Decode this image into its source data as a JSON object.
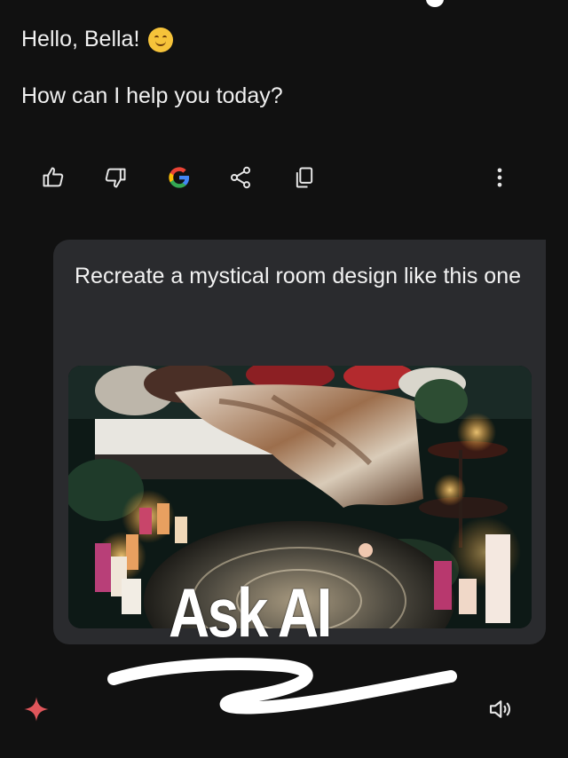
{
  "greeting": {
    "text": "Hello, Bella!",
    "emoji": "smiling-face"
  },
  "prompt": {
    "text": "How can I help you today?"
  },
  "actions": [
    {
      "name": "thumbs-up",
      "label": "Good response"
    },
    {
      "name": "thumbs-down",
      "label": "Bad response"
    },
    {
      "name": "google",
      "label": "G"
    },
    {
      "name": "share",
      "label": "Share"
    },
    {
      "name": "copy",
      "label": "Copy"
    },
    {
      "name": "more",
      "label": "More"
    }
  ],
  "user_message": {
    "text": "Recreate a mystical room design like this one",
    "image_alt": "mystical room with fur throw, pillows, candles and plants"
  },
  "overlay": {
    "title": "Ask AI"
  },
  "bottom": {
    "sparkle_icon": "sparkle-icon",
    "speaker_icon": "speaker-icon"
  },
  "colors": {
    "background": "#111111",
    "bubble": "#2a2b2e",
    "sparkle": "#e0565b",
    "text": "#f0f0f0"
  }
}
